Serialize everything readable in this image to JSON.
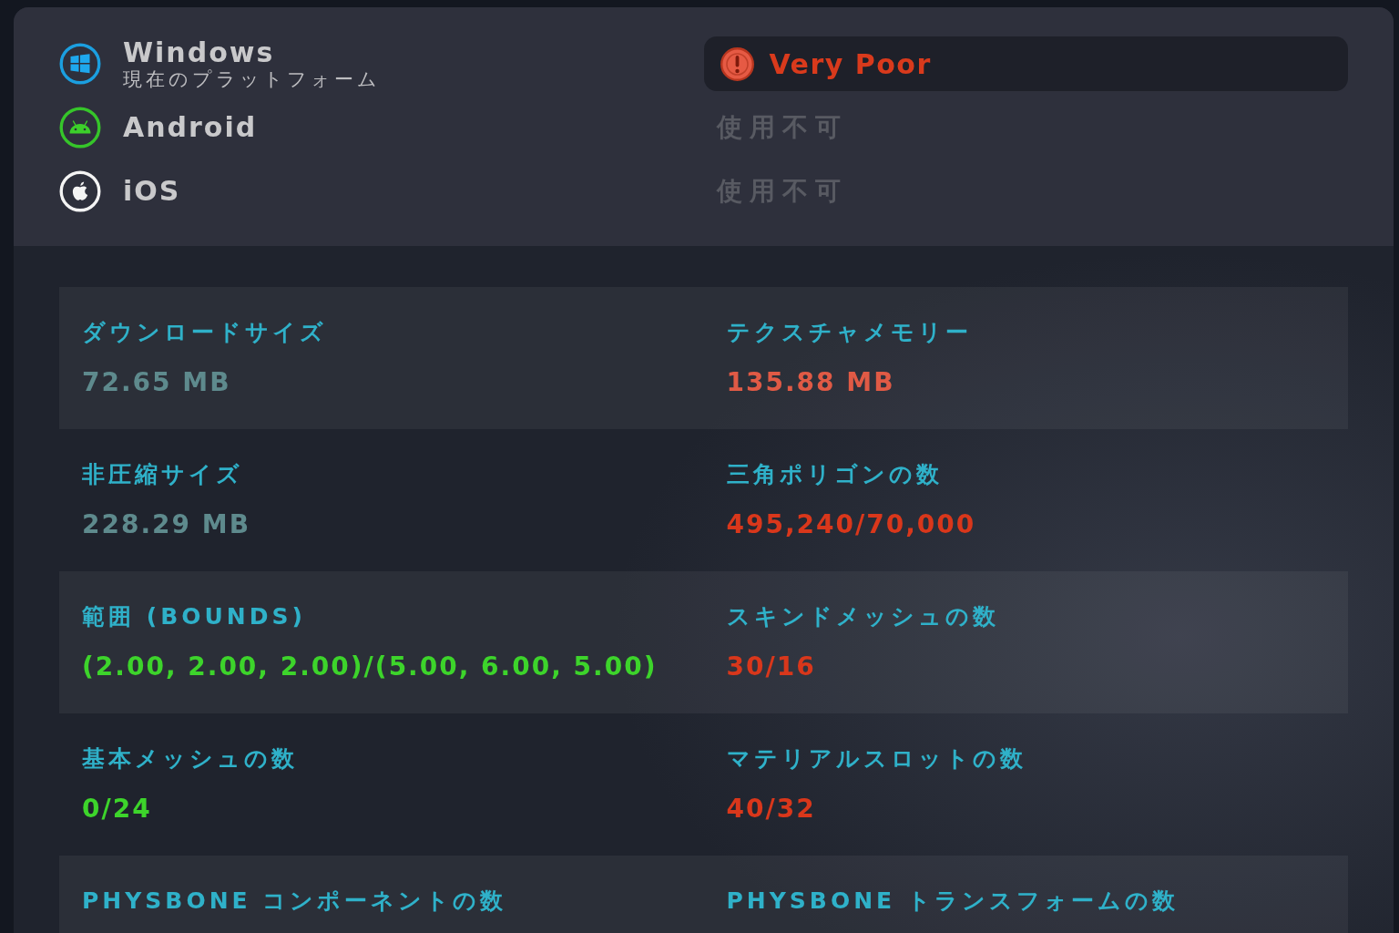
{
  "platforms": [
    {
      "kind": "windows",
      "name": "Windows",
      "subtitle": "現在のプラットフォーム",
      "status": {
        "kind": "rating",
        "text": "Very Poor"
      }
    },
    {
      "kind": "android",
      "name": "Android",
      "status": {
        "kind": "unavailable",
        "text": "使用不可"
      }
    },
    {
      "kind": "ios",
      "name": "iOS",
      "status": {
        "kind": "unavailable",
        "text": "使用不可"
      }
    }
  ],
  "stats": [
    {
      "items": [
        {
          "label": "ダウンロードサイズ",
          "value": "72.65 MB",
          "color": "#5e8a8d"
        },
        {
          "label": "テクスチャメモリー",
          "value": "135.88 MB",
          "color": "#e05a45"
        }
      ]
    },
    {
      "items": [
        {
          "label": "非圧縮サイズ",
          "value": "228.29 MB",
          "color": "#5e8a8d"
        },
        {
          "label": "三角ポリゴンの数",
          "value": "495,240/70,000",
          "color": "#d9371b"
        }
      ]
    },
    {
      "items": [
        {
          "label": "範囲 (BOUNDS)",
          "value": "(2.00, 2.00, 2.00)/(5.00, 6.00, 5.00)",
          "color": "#3dd42b"
        },
        {
          "label": "スキンドメッシュの数",
          "value": "30/16",
          "color": "#d9371b"
        }
      ]
    },
    {
      "items": [
        {
          "label": "基本メッシュの数",
          "value": "0/24",
          "color": "#3dd42b"
        },
        {
          "label": "マテリアルスロットの数",
          "value": "40/32",
          "color": "#d9371b"
        }
      ]
    },
    {
      "items": [
        {
          "label": "PHYSBONE コンポーネントの数"
        },
        {
          "label": "PHYSBONE トランスフォームの数"
        }
      ]
    }
  ]
}
